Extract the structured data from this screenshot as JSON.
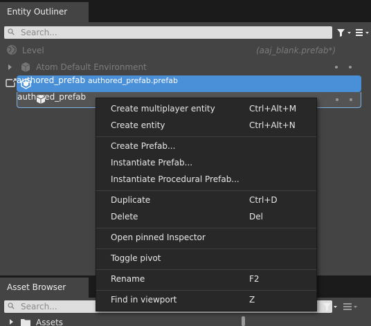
{
  "outliner": {
    "tab_label": "Entity Outliner",
    "search_placeholder": "Search...",
    "level": {
      "label": "Level",
      "file": "(aaj_blank.prefab*)"
    },
    "atom_env": {
      "label": "Atom Default Environment"
    },
    "prefab": {
      "label": "authored_prefab",
      "file": "authored_prefab.prefab"
    },
    "prefab_child": {
      "label": "authored_prefab"
    }
  },
  "context_menu": {
    "items": [
      {
        "label": "Create multiplayer entity",
        "shortcut": "Ctrl+Alt+M"
      },
      {
        "label": "Create entity",
        "shortcut": "Ctrl+Alt+N"
      },
      {
        "label": "Create Prefab...",
        "shortcut": ""
      },
      {
        "label": "Instantiate Prefab...",
        "shortcut": ""
      },
      {
        "label": "Instantiate Procedural Prefab...",
        "shortcut": ""
      },
      {
        "label": "Duplicate",
        "shortcut": "Ctrl+D"
      },
      {
        "label": "Delete",
        "shortcut": "Del"
      },
      {
        "label": "Open pinned Inspector",
        "shortcut": ""
      },
      {
        "label": "Toggle pivot",
        "shortcut": ""
      },
      {
        "label": "Rename",
        "shortcut": "F2"
      },
      {
        "label": "Find in viewport",
        "shortcut": "Z"
      }
    ]
  },
  "asset_browser": {
    "tab_label": "Asset Browser",
    "search_placeholder": "Search...",
    "root_folder": "Assets"
  },
  "colors": {
    "selection": "#4a90d9",
    "selection_border": "#7fb3e8",
    "panel": "#444444",
    "menu": "#282828"
  }
}
